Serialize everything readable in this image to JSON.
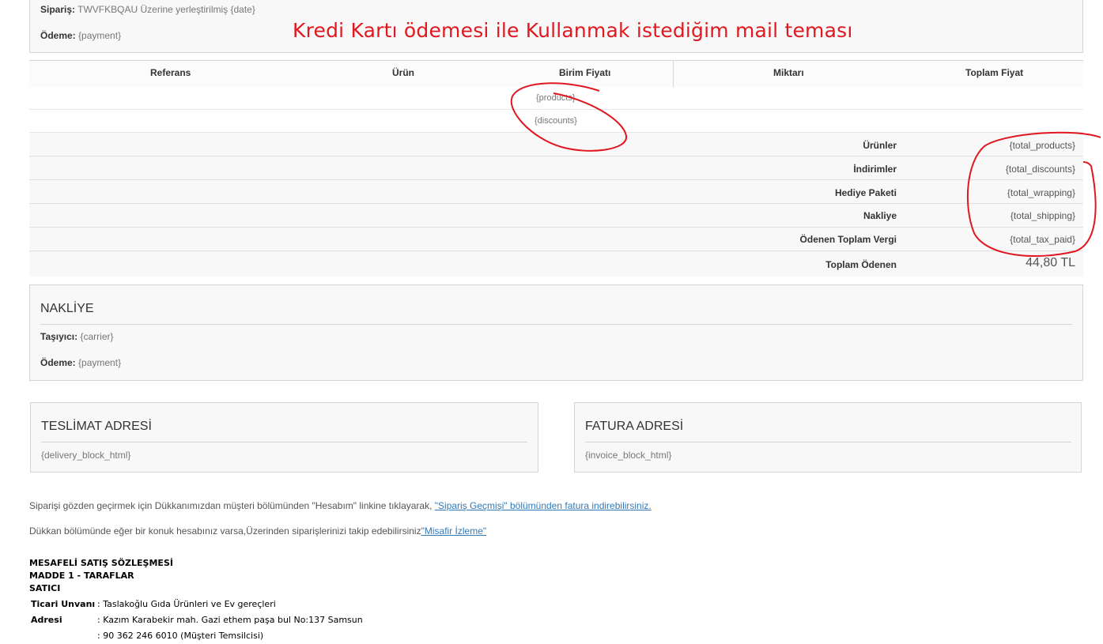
{
  "order_box": {
    "order_label": "Sipariş:",
    "order_value": "TWVFKBQAU Üzerine yerleştirilmiş {date}",
    "payment_label": "Ödeme:",
    "payment_value": "{payment}"
  },
  "annotation": {
    "text": "Kredi Kartı ödemesi ile Kullanmak istediğim mail teması",
    "color": "#e0181f"
  },
  "table": {
    "headers": {
      "reference": "Referans",
      "product": "Ürün",
      "unit_price": "Birim Fiyatı",
      "quantity": "Miktarı",
      "total_price": "Toplam Fiyat"
    },
    "products_placeholder": "{products}",
    "discounts_placeholder": "{discounts}",
    "summary": [
      {
        "label": "Ürünler",
        "value": "{total_products}"
      },
      {
        "label": "İndirimler",
        "value": "{total_discounts}"
      },
      {
        "label": "Hediye Paketi",
        "value": "{total_wrapping}"
      },
      {
        "label": "Nakliye",
        "value": "{total_shipping}"
      },
      {
        "label": "Ödenen Toplam Vergi",
        "value": "{total_tax_paid}"
      }
    ],
    "grand_total_label": "Toplam Ödenen",
    "grand_total_value": "44,80 TL"
  },
  "shipping": {
    "title": "NAKLİYE",
    "carrier_label": "Taşıyıcı:",
    "carrier_value": "{carrier}",
    "payment_label": "Ödeme:",
    "payment_value": "{payment}"
  },
  "delivery_address": {
    "title": "TESLİMAT ADRESİ",
    "value": "{delivery_block_html}"
  },
  "invoice_address": {
    "title": "FATURA ADRESİ",
    "value": "{invoice_block_html}"
  },
  "footer": {
    "line1_text": "Siparişi gözden geçirmek için Dükkanımızdan müşteri bölümünden \"Hesabım\" linkine tıklayarak,",
    "line1_link": "\"Sipariş Geçmişi\" bölümünden fatura indirebilirsiniz.",
    "line2_text": "Dükkan bölümünde eğer bir konuk hesabınız varsa,Üzerinden siparişlerinizi takip edebilirsiniz",
    "line2_link": "\"Misafir İzleme\""
  },
  "contract": {
    "title": "MESAFELİ SATIŞ SÖZLEŞMESİ",
    "article": "MADDE 1 - TARAFLAR",
    "party": "SATICI",
    "rows": [
      {
        "label": "Ticari Unvanı",
        "value": ": Taslakoğlu Gıda Ürünleri ve Ev gereçleri"
      },
      {
        "label": "Adresi",
        "value": ": Kazım Karabekir mah. Gazi ethem paşa bul No:137 Samsun"
      },
      {
        "label": "",
        "value": ": 90 362 246 6010 (Müşteri Temsilcisi)"
      }
    ]
  }
}
